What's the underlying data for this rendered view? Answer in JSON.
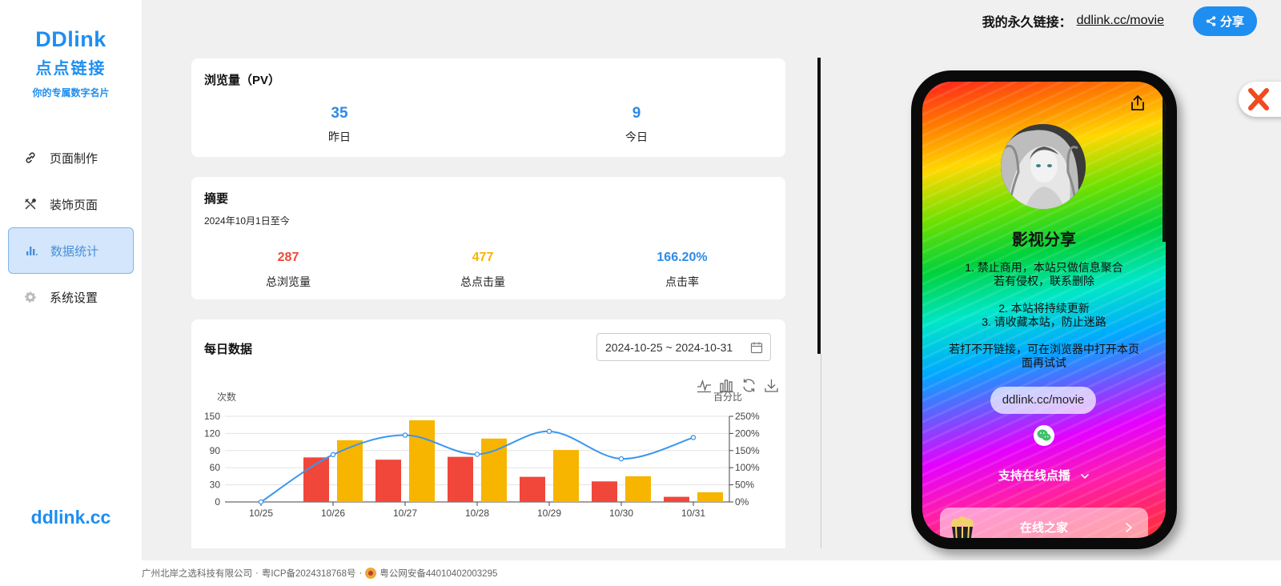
{
  "sidebar": {
    "brand_en": "DDlink",
    "brand_cn": "点点链接",
    "brand_sub": "你的专属数字名片",
    "items": [
      {
        "label": "页面制作",
        "icon": "link-icon"
      },
      {
        "label": "装饰页面",
        "icon": "tools-icon"
      },
      {
        "label": "数据统计",
        "icon": "bar-chart-icon",
        "active": true
      },
      {
        "label": "系统设置",
        "icon": "gear-icon"
      }
    ],
    "footer": "ddlink.cc"
  },
  "topbar": {
    "perma_label": "我的永久链接：",
    "perma_link": "ddlink.cc/movie",
    "share": "分享"
  },
  "pv_card": {
    "title": "浏览量（PV）",
    "yesterday": {
      "value": "35",
      "label": "昨日"
    },
    "today": {
      "value": "9",
      "label": "今日"
    }
  },
  "summary_card": {
    "title": "摘要",
    "period": "2024年10月1日至今",
    "total_views": {
      "value": "287",
      "label": "总浏览量",
      "color": "#f0473a"
    },
    "total_clicks": {
      "value": "477",
      "label": "总点击量",
      "color": "#f7b500"
    },
    "ctr": {
      "value": "166.20%",
      "label": "点击率",
      "color": "#2e8ae6"
    }
  },
  "daily_card": {
    "title": "每日数据",
    "date_range": "2024-10-25 ~ 2024-10-31"
  },
  "chart_data": {
    "type": "bar",
    "categories": [
      "10/25",
      "10/26",
      "10/27",
      "10/28",
      "10/29",
      "10/30",
      "10/31"
    ],
    "series": [
      {
        "type": "bar",
        "values": [
          0,
          78,
          74,
          79,
          44,
          36,
          9
        ],
        "color": "#f0473a"
      },
      {
        "type": "bar",
        "values": [
          0,
          108,
          143,
          111,
          91,
          45,
          17
        ],
        "color": "#f7b500"
      },
      {
        "type": "line",
        "axis": "right",
        "values": [
          0,
          138,
          195,
          139,
          206,
          126,
          188
        ],
        "color": "#3b96ef"
      }
    ],
    "ylabel": "次数",
    "ylabel_right": "百分比",
    "ylim": [
      0,
      150
    ],
    "yticks": [
      0,
      30,
      60,
      90,
      120,
      150
    ],
    "ylim_right": [
      0,
      250
    ],
    "yticks_right": [
      "0%",
      "50%",
      "100%",
      "150%",
      "200%",
      "250%"
    ],
    "grid": true
  },
  "phone": {
    "title": "影视分享",
    "line1": "1. 禁止商用，本站只做信息聚合",
    "line2": "若有侵权，联系删除",
    "line3": "2. 本站将持续更新",
    "line4": "3. 请收藏本站，防止迷路",
    "line5": "若打不开链接，可在浏览器中打开本页",
    "line6": "面再试试",
    "pill": "ddlink.cc/movie",
    "support": "支持在线点播",
    "card": "在线之家"
  },
  "footer": {
    "company": "广州北岸之选科技有限公司",
    "icp": "粤ICP备2024318768号",
    "police": "粤公网安备44010402003295",
    "sep": "·"
  }
}
